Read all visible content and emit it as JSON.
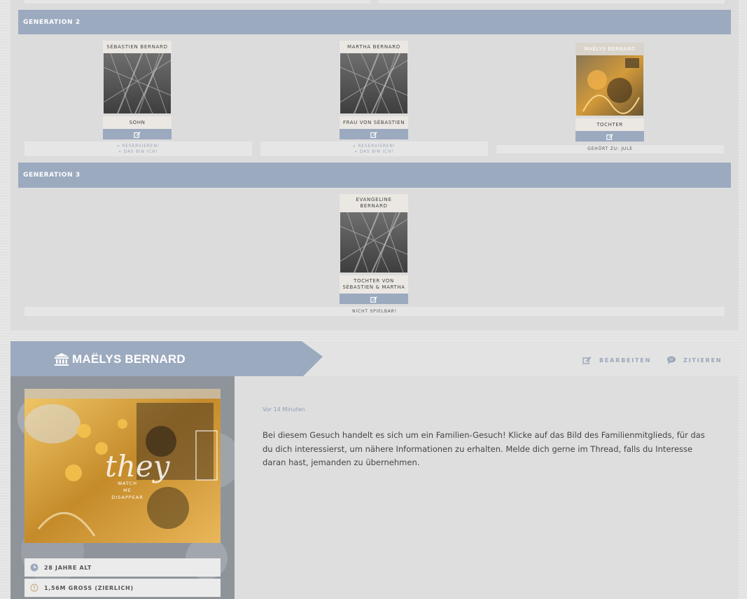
{
  "generations": [
    {
      "title": "GENERATION 2",
      "members": [
        {
          "name": "SÉBASTIEN BERNARD",
          "role": "SOHN",
          "status": [
            "» RESERVIEREN!",
            "» DAS BIN ICH!"
          ]
        },
        {
          "name": "MARTHA BERNARD",
          "role": "FRAU VON SÉBASTIEN",
          "status": [
            "» RESERVIEREN!",
            "» DAS BIN ICH!"
          ]
        },
        {
          "name": "MAËLYS BERNARD",
          "role": "TOCHTER",
          "status": [
            "GEHÖRT ZU: JULE"
          ]
        }
      ]
    },
    {
      "title": "GENERATION 3",
      "members": [
        {
          "name": "EVANGELINE BERNARD",
          "role": "TOCHTER VON SÉBASTIEN & MARTHA",
          "status": [
            "NICHT SPIELBAR!"
          ]
        }
      ]
    }
  ],
  "post": {
    "title": "MAËLYS BERNARD",
    "actions": {
      "edit": "BEARBEITEN",
      "quote": "ZITIEREN"
    },
    "time": "Vor 14 Minuten",
    "text": "Bei diesem Gesuch handelt es sich um ein Familien-Gesuch! Klicke auf das Bild des Familienmitglieds, für das du dich interessierst, um nähere Informationen zu erhalten. Melde dich gerne im Thread, falls du Interesse daran hast, jemanden zu übernehmen.",
    "avatar_text": {
      "script": "they",
      "lines": [
        "WATCH",
        "ME",
        "DISAPPEAR"
      ]
    },
    "info": [
      "28 JAHRE ALT",
      "1,56M GROSS (ZIERLICH)"
    ]
  },
  "colors": {
    "accent": "#9caabf",
    "card": "#ebe8e3",
    "link": "#9aa6b8"
  },
  "icons": {
    "edit": "edit-icon",
    "quote": "speech-bubble-icon",
    "title": "bank-icon",
    "age": "clock-icon",
    "height": "alert-icon"
  }
}
